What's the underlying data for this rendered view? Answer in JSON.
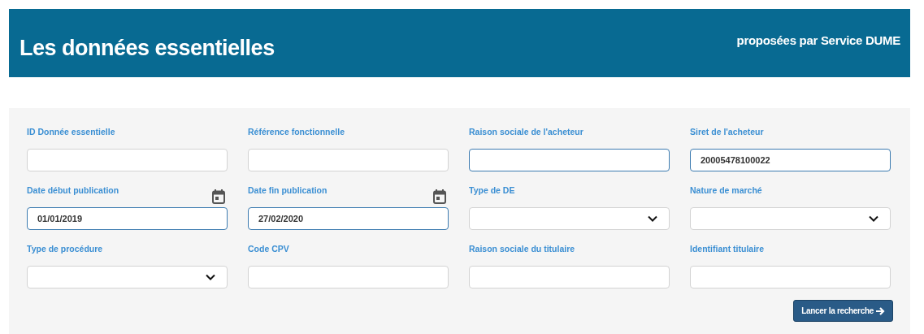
{
  "header": {
    "title": "Les données essentielles",
    "subtitle": "proposées par Service DUME"
  },
  "fields": [
    {
      "label": "ID Donnée essentielle",
      "kind": "text",
      "highlighted": false
    },
    {
      "label": "Référence fonctionnelle",
      "kind": "text",
      "highlighted": false
    },
    {
      "label": "Raison sociale de l'acheteur",
      "kind": "text",
      "highlighted": true
    },
    {
      "label": "Siret de l'acheteur",
      "kind": "text",
      "highlighted": true,
      "value": "20005478100022"
    },
    {
      "label": "Date début publication",
      "kind": "date",
      "highlighted": true,
      "value": "01/01/2019"
    },
    {
      "label": "Date fin publication",
      "kind": "date",
      "highlighted": true,
      "value": "27/02/2020"
    },
    {
      "label": "Type de DE",
      "kind": "select",
      "highlighted": false
    },
    {
      "label": "Nature de marché",
      "kind": "select",
      "highlighted": false
    },
    {
      "label": "Type de procédure",
      "kind": "select",
      "highlighted": false
    },
    {
      "label": "Code CPV",
      "kind": "text",
      "highlighted": false
    },
    {
      "label": "Raison sociale du titulaire",
      "kind": "text",
      "highlighted": false
    },
    {
      "label": "Identifiant titulaire",
      "kind": "text",
      "highlighted": false
    }
  ],
  "search_button": {
    "label": "Lancer la recherche"
  }
}
